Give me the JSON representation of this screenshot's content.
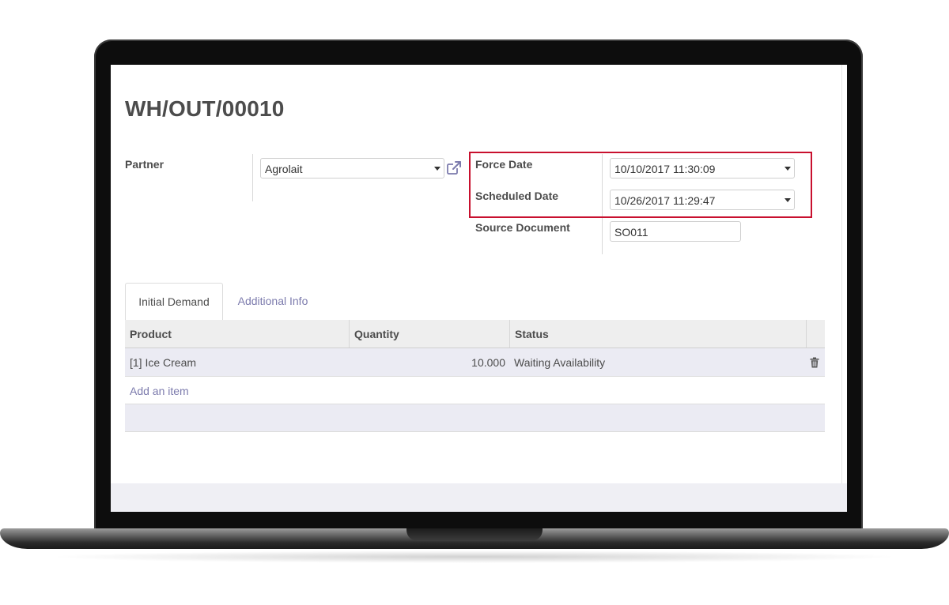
{
  "record": {
    "title": "WH/OUT/00010"
  },
  "form": {
    "partner": {
      "label": "Partner",
      "value": "Agrolait"
    },
    "force_date": {
      "label": "Force Date",
      "value": "10/10/2017 11:30:09"
    },
    "scheduled_date": {
      "label": "Scheduled Date",
      "value": "10/26/2017 11:29:47"
    },
    "source_document": {
      "label": "Source Document",
      "value": "SO011"
    }
  },
  "tabs": [
    {
      "label": "Initial Demand",
      "active": true
    },
    {
      "label": "Additional Info",
      "active": false
    }
  ],
  "table": {
    "columns": [
      "Product",
      "Quantity",
      "Status"
    ],
    "rows": [
      {
        "product": "[1] Ice Cream",
        "quantity": "10.000",
        "status": "Waiting Availability"
      }
    ],
    "add_item_label": "Add an item"
  },
  "colors": {
    "highlight": "#c8102e",
    "link": "#7c7bad",
    "row_bg": "#ebebf3"
  },
  "icons": {
    "external_link": "external-link-icon",
    "dropdown": "caret-down-icon",
    "delete": "trash-icon"
  }
}
